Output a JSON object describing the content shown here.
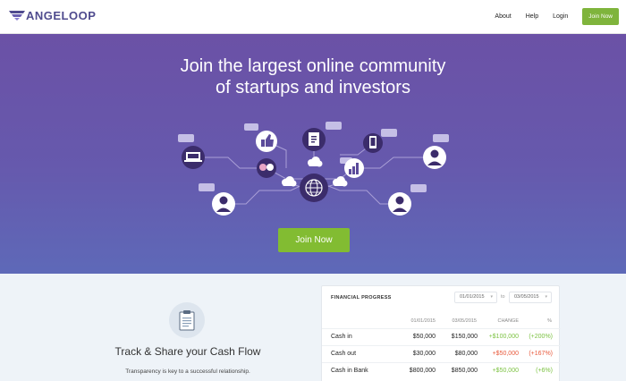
{
  "header": {
    "brand": "ANGELOOP",
    "nav": [
      "About",
      "Help",
      "Login"
    ],
    "join_label": "Join Now"
  },
  "hero": {
    "title_line1": "Join the largest online community",
    "title_line2": "of startups and investors",
    "cta_label": "Join Now"
  },
  "feature": {
    "title": "Track & Share your Cash Flow",
    "text": "Transparency is key to a successful relationship."
  },
  "financial": {
    "title": "FINANCIAL PROGRESS",
    "date_from": "01/01/2015",
    "to_label": "to",
    "date_to": "03/05/2015",
    "columns": [
      "01/01/2015",
      "03/05/2015",
      "CHANGE",
      "%"
    ],
    "rows": [
      {
        "label": "Cash in",
        "from": "$50,000",
        "to": "$150,000",
        "change": "+$100,000",
        "pct": "(+200%)",
        "change_color": "#7cc242",
        "pct_color": "#7cc242"
      },
      {
        "label": "Cash out",
        "from": "$30,000",
        "to": "$80,000",
        "change": "+$50,000",
        "pct": "(+167%)",
        "change_color": "#e8593b",
        "pct_color": "#e8593b"
      },
      {
        "label": "Cash in Bank",
        "from": "$800,000",
        "to": "$850,000",
        "change": "+$50,000",
        "pct": "(+6%)",
        "change_color": "#7cc242",
        "pct_color": "#7cc242"
      }
    ]
  },
  "colors": {
    "brand": "#4f4b8e",
    "accent_green": "#82bc32",
    "hero_top": "#6b51a6",
    "hero_bottom": "#5e69b8"
  },
  "icons": [
    "logo-wing-icon",
    "laptop-icon",
    "hands-icon",
    "thumbs-up-icon",
    "document-icon",
    "globe-network-icon",
    "phone-icon",
    "chart-icon",
    "person-icon",
    "cloud-icon",
    "speech-bubble-icon",
    "clipboard-icon",
    "caret-down-icon"
  ]
}
